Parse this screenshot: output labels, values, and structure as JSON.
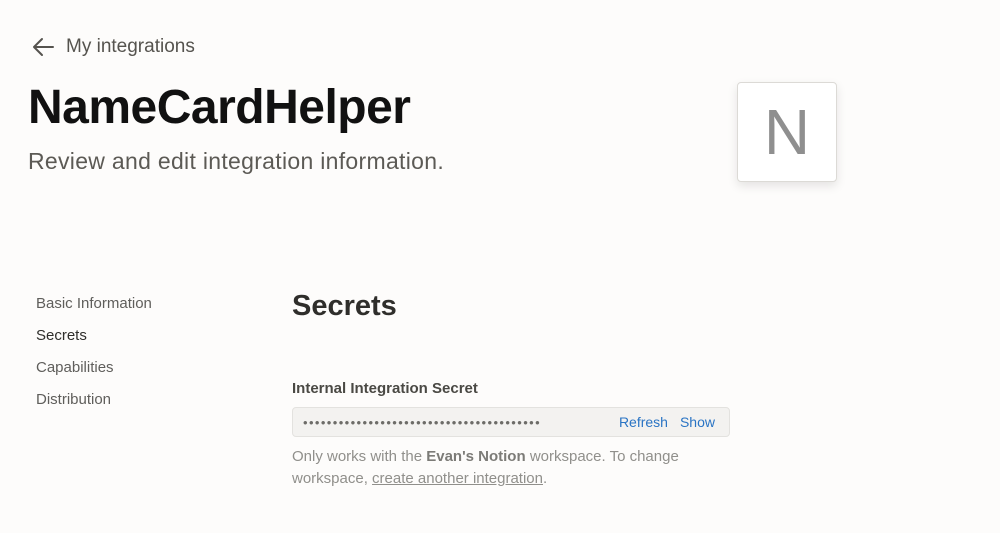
{
  "header": {
    "back_label": "My integrations",
    "title": "NameCardHelper",
    "subtitle": "Review and edit integration information.",
    "logo_letter": "N"
  },
  "sidebar": {
    "items": [
      {
        "label": "Basic Information",
        "active": false
      },
      {
        "label": "Secrets",
        "active": true
      },
      {
        "label": "Capabilities",
        "active": false
      },
      {
        "label": "Distribution",
        "active": false
      }
    ]
  },
  "main": {
    "section_title": "Secrets",
    "secret": {
      "label": "Internal Integration Secret",
      "masked_value": "••••••••••••••••••••••••••••••••••••••••",
      "refresh_label": "Refresh",
      "show_label": "Show"
    },
    "help": {
      "prefix": "Only works with the",
      "workspace_name": "Evan's Notion",
      "middle": "workspace. To change workspace,",
      "link_text": "create another integration",
      "suffix": "."
    }
  },
  "colors": {
    "background": "#fdfcfb",
    "link": "#2a74c4",
    "title": "#111111"
  }
}
